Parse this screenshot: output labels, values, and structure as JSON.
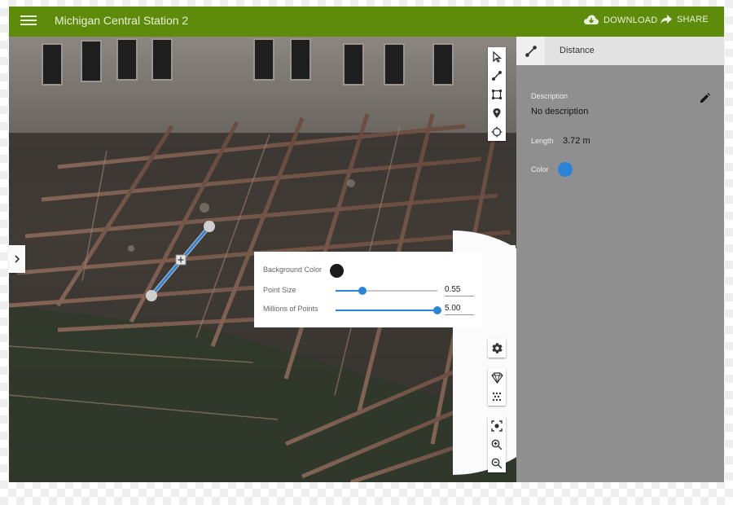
{
  "app": {
    "title": "Michigan Central Station 2",
    "download_label": "DOWNLOAD",
    "share_label": "SHARE",
    "accent_color": "#5e8b0a"
  },
  "right_panel": {
    "tool_title": "Distance",
    "description_label": "Description",
    "description_value": "No description",
    "length_label": "Length",
    "length_value": "3.72 m",
    "color_label": "Color",
    "color_value": "#2b84d8"
  },
  "viewer_settings": {
    "background_color_label": "Background Color",
    "background_color_value": "#1a1a1a",
    "point_size_label": "Point Size",
    "point_size_value": "0.55",
    "point_size_fraction": 0.26,
    "millions_points_label": "Millions of Points",
    "millions_points_value": "5.00",
    "millions_points_fraction": 1.0
  },
  "toolbar_icons": [
    "select-icon",
    "measure-distance-icon",
    "measure-area-icon",
    "place-marker-icon",
    "crosshair-icon",
    "settings-icon",
    "point-style-icon",
    "density-icon",
    "fit-view-icon",
    "zoom-in-icon",
    "zoom-out-icon"
  ]
}
